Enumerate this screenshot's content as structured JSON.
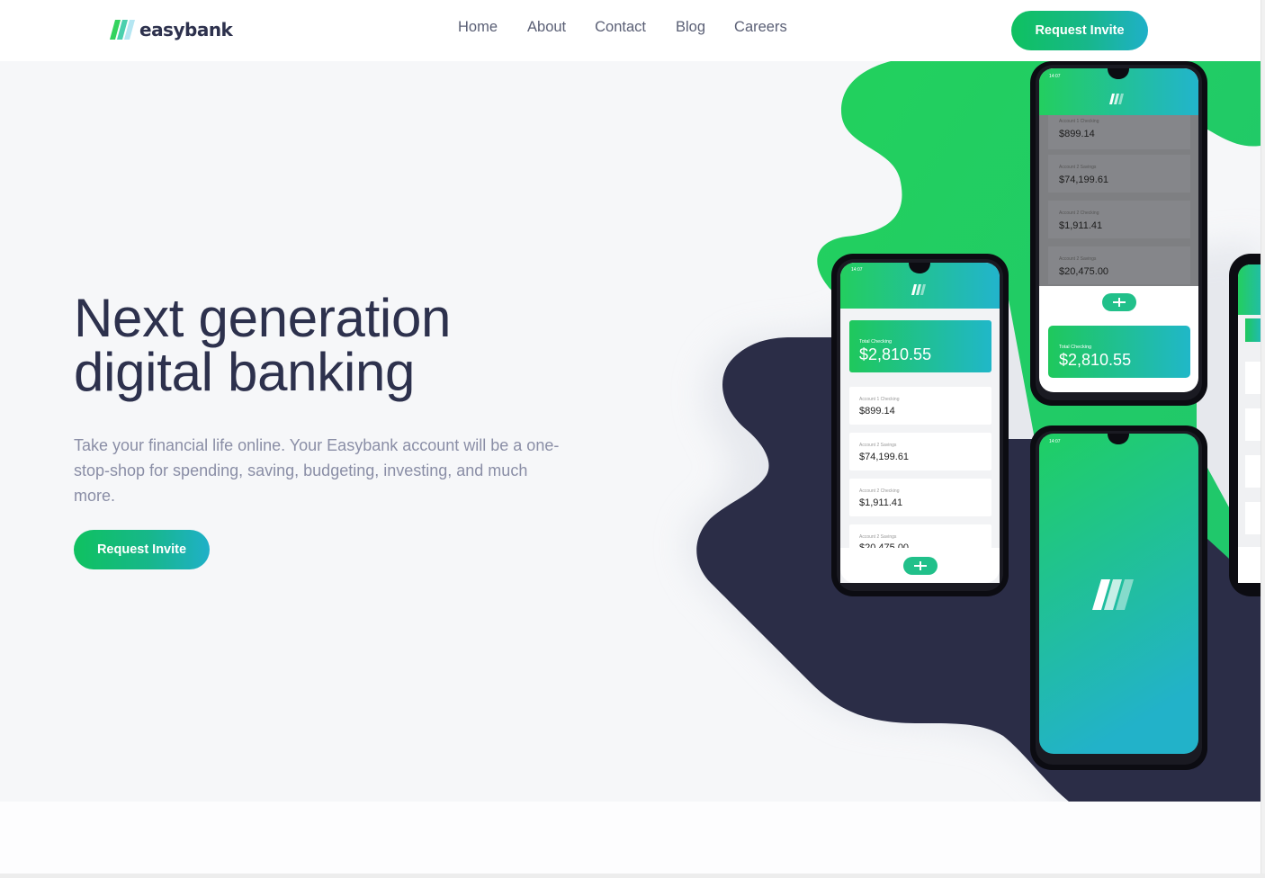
{
  "brand": {
    "name": "easybank"
  },
  "nav": {
    "links": [
      {
        "label": "Home"
      },
      {
        "label": "About"
      },
      {
        "label": "Contact"
      },
      {
        "label": "Blog"
      },
      {
        "label": "Careers"
      }
    ]
  },
  "header": {
    "cta_label": "Request Invite"
  },
  "hero": {
    "title_line1": "Next generation",
    "title_line2": "digital banking",
    "description": "Take your financial life online. Your Easybank account will be a one-stop-shop for spending, saving, budgeting, investing, and much more.",
    "cta_label": "Request Invite"
  },
  "phones": {
    "status_time": "14:07",
    "total_label": "Total Checking",
    "total_value": "$2,810.55",
    "accounts": [
      {
        "label": "Account 1 Checking",
        "value": "$899.14"
      },
      {
        "label": "Account 2 Savings",
        "value": "$74,199.61"
      },
      {
        "label": "Account 2 Checking",
        "value": "$1,911.41"
      },
      {
        "label": "Account 2 Savings",
        "value": "$20,475.00"
      }
    ]
  },
  "colors": {
    "dark_blue": "#2d314d",
    "lime_green": "#31d35c",
    "bright_cyan": "#2bb7da",
    "grayish_blue": "#9698a6",
    "light_bg": "#f4f5f7"
  }
}
